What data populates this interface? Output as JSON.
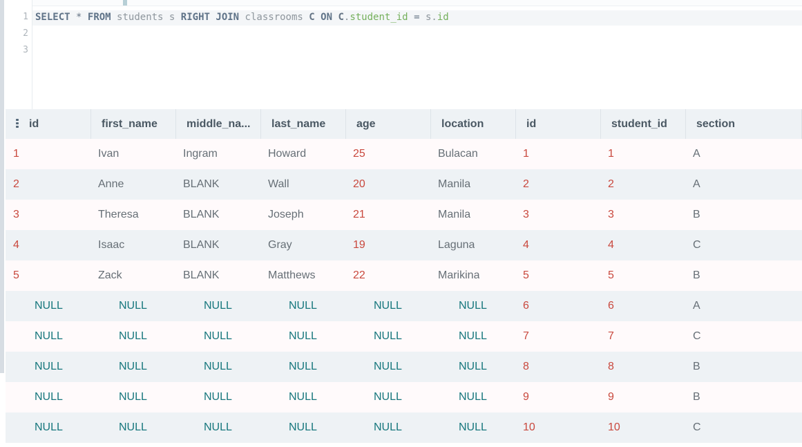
{
  "editor": {
    "line_numbers": [
      "1",
      "2",
      "3"
    ],
    "query_tokens": [
      {
        "text": "SELECT",
        "kind": "keyword"
      },
      {
        "text": " ",
        "kind": "space"
      },
      {
        "text": "*",
        "kind": "operator"
      },
      {
        "text": " ",
        "kind": "space"
      },
      {
        "text": "FROM",
        "kind": "keyword"
      },
      {
        "text": " ",
        "kind": "space"
      },
      {
        "text": "students",
        "kind": "ident"
      },
      {
        "text": " ",
        "kind": "space"
      },
      {
        "text": "s",
        "kind": "ident"
      },
      {
        "text": " ",
        "kind": "space"
      },
      {
        "text": "RIGHT",
        "kind": "keyword"
      },
      {
        "text": " ",
        "kind": "space"
      },
      {
        "text": "JOIN",
        "kind": "keyword"
      },
      {
        "text": " ",
        "kind": "space"
      },
      {
        "text": "classrooms",
        "kind": "ident"
      },
      {
        "text": " ",
        "kind": "space"
      },
      {
        "text": "C",
        "kind": "alias"
      },
      {
        "text": " ",
        "kind": "space"
      },
      {
        "text": "ON",
        "kind": "keyword"
      },
      {
        "text": " ",
        "kind": "space"
      },
      {
        "text": "C",
        "kind": "alias"
      },
      {
        "text": ".",
        "kind": "punc"
      },
      {
        "text": "student_id",
        "kind": "field"
      },
      {
        "text": " ",
        "kind": "space"
      },
      {
        "text": "=",
        "kind": "operator"
      },
      {
        "text": " ",
        "kind": "space"
      },
      {
        "text": "s",
        "kind": "ident"
      },
      {
        "text": ".",
        "kind": "punc"
      },
      {
        "text": "id",
        "kind": "field"
      }
    ]
  },
  "results": {
    "columns": [
      "id",
      "first_name",
      "middle_na...",
      "last_name",
      "age",
      "location",
      "id",
      "student_id",
      "section"
    ],
    "column_icon": "column-grip-icon",
    "rows": [
      [
        {
          "text": "1",
          "kind": "num"
        },
        {
          "text": "Ivan",
          "kind": "txt"
        },
        {
          "text": "Ingram",
          "kind": "txt"
        },
        {
          "text": "Howard",
          "kind": "txt"
        },
        {
          "text": "25",
          "kind": "num"
        },
        {
          "text": "Bulacan",
          "kind": "txt"
        },
        {
          "text": "1",
          "kind": "num"
        },
        {
          "text": "1",
          "kind": "num"
        },
        {
          "text": "A",
          "kind": "txt"
        }
      ],
      [
        {
          "text": "2",
          "kind": "num"
        },
        {
          "text": "Anne",
          "kind": "txt"
        },
        {
          "text": "BLANK",
          "kind": "txt"
        },
        {
          "text": "Wall",
          "kind": "txt"
        },
        {
          "text": "20",
          "kind": "num"
        },
        {
          "text": "Manila",
          "kind": "txt"
        },
        {
          "text": "2",
          "kind": "num"
        },
        {
          "text": "2",
          "kind": "num"
        },
        {
          "text": "A",
          "kind": "txt"
        }
      ],
      [
        {
          "text": "3",
          "kind": "num"
        },
        {
          "text": "Theresa",
          "kind": "txt"
        },
        {
          "text": "BLANK",
          "kind": "txt"
        },
        {
          "text": "Joseph",
          "kind": "txt"
        },
        {
          "text": "21",
          "kind": "num"
        },
        {
          "text": "Manila",
          "kind": "txt"
        },
        {
          "text": "3",
          "kind": "num"
        },
        {
          "text": "3",
          "kind": "num"
        },
        {
          "text": "B",
          "kind": "txt"
        }
      ],
      [
        {
          "text": "4",
          "kind": "num"
        },
        {
          "text": "Isaac",
          "kind": "txt"
        },
        {
          "text": "BLANK",
          "kind": "txt"
        },
        {
          "text": "Gray",
          "kind": "txt"
        },
        {
          "text": "19",
          "kind": "num"
        },
        {
          "text": "Laguna",
          "kind": "txt"
        },
        {
          "text": "4",
          "kind": "num"
        },
        {
          "text": "4",
          "kind": "num"
        },
        {
          "text": "C",
          "kind": "txt"
        }
      ],
      [
        {
          "text": "5",
          "kind": "num"
        },
        {
          "text": "Zack",
          "kind": "txt"
        },
        {
          "text": "BLANK",
          "kind": "txt"
        },
        {
          "text": "Matthews",
          "kind": "txt"
        },
        {
          "text": "22",
          "kind": "num"
        },
        {
          "text": "Marikina",
          "kind": "txt"
        },
        {
          "text": "5",
          "kind": "num"
        },
        {
          "text": "5",
          "kind": "num"
        },
        {
          "text": "B",
          "kind": "txt"
        }
      ],
      [
        {
          "text": "NULL",
          "kind": "null"
        },
        {
          "text": "NULL",
          "kind": "null"
        },
        {
          "text": "NULL",
          "kind": "null"
        },
        {
          "text": "NULL",
          "kind": "null"
        },
        {
          "text": "NULL",
          "kind": "null"
        },
        {
          "text": "NULL",
          "kind": "null"
        },
        {
          "text": "6",
          "kind": "num"
        },
        {
          "text": "6",
          "kind": "num"
        },
        {
          "text": "A",
          "kind": "txt"
        }
      ],
      [
        {
          "text": "NULL",
          "kind": "null"
        },
        {
          "text": "NULL",
          "kind": "null"
        },
        {
          "text": "NULL",
          "kind": "null"
        },
        {
          "text": "NULL",
          "kind": "null"
        },
        {
          "text": "NULL",
          "kind": "null"
        },
        {
          "text": "NULL",
          "kind": "null"
        },
        {
          "text": "7",
          "kind": "num"
        },
        {
          "text": "7",
          "kind": "num"
        },
        {
          "text": "C",
          "kind": "txt"
        }
      ],
      [
        {
          "text": "NULL",
          "kind": "null"
        },
        {
          "text": "NULL",
          "kind": "null"
        },
        {
          "text": "NULL",
          "kind": "null"
        },
        {
          "text": "NULL",
          "kind": "null"
        },
        {
          "text": "NULL",
          "kind": "null"
        },
        {
          "text": "NULL",
          "kind": "null"
        },
        {
          "text": "8",
          "kind": "num"
        },
        {
          "text": "8",
          "kind": "num"
        },
        {
          "text": "B",
          "kind": "txt"
        }
      ],
      [
        {
          "text": "NULL",
          "kind": "null"
        },
        {
          "text": "NULL",
          "kind": "null"
        },
        {
          "text": "NULL",
          "kind": "null"
        },
        {
          "text": "NULL",
          "kind": "null"
        },
        {
          "text": "NULL",
          "kind": "null"
        },
        {
          "text": "NULL",
          "kind": "null"
        },
        {
          "text": "9",
          "kind": "num"
        },
        {
          "text": "9",
          "kind": "num"
        },
        {
          "text": "B",
          "kind": "txt"
        }
      ],
      [
        {
          "text": "NULL",
          "kind": "null"
        },
        {
          "text": "NULL",
          "kind": "null"
        },
        {
          "text": "NULL",
          "kind": "null"
        },
        {
          "text": "NULL",
          "kind": "null"
        },
        {
          "text": "NULL",
          "kind": "null"
        },
        {
          "text": "NULL",
          "kind": "null"
        },
        {
          "text": "10",
          "kind": "num"
        },
        {
          "text": "10",
          "kind": "num"
        },
        {
          "text": "C",
          "kind": "txt"
        }
      ]
    ]
  },
  "colors": {
    "editor_keyword": "#5f7388",
    "editor_field": "#74b05b",
    "numeric": "#c9483d",
    "null_value": "#15767c",
    "text_value": "#666f76",
    "header_background": "#eef2f5"
  }
}
